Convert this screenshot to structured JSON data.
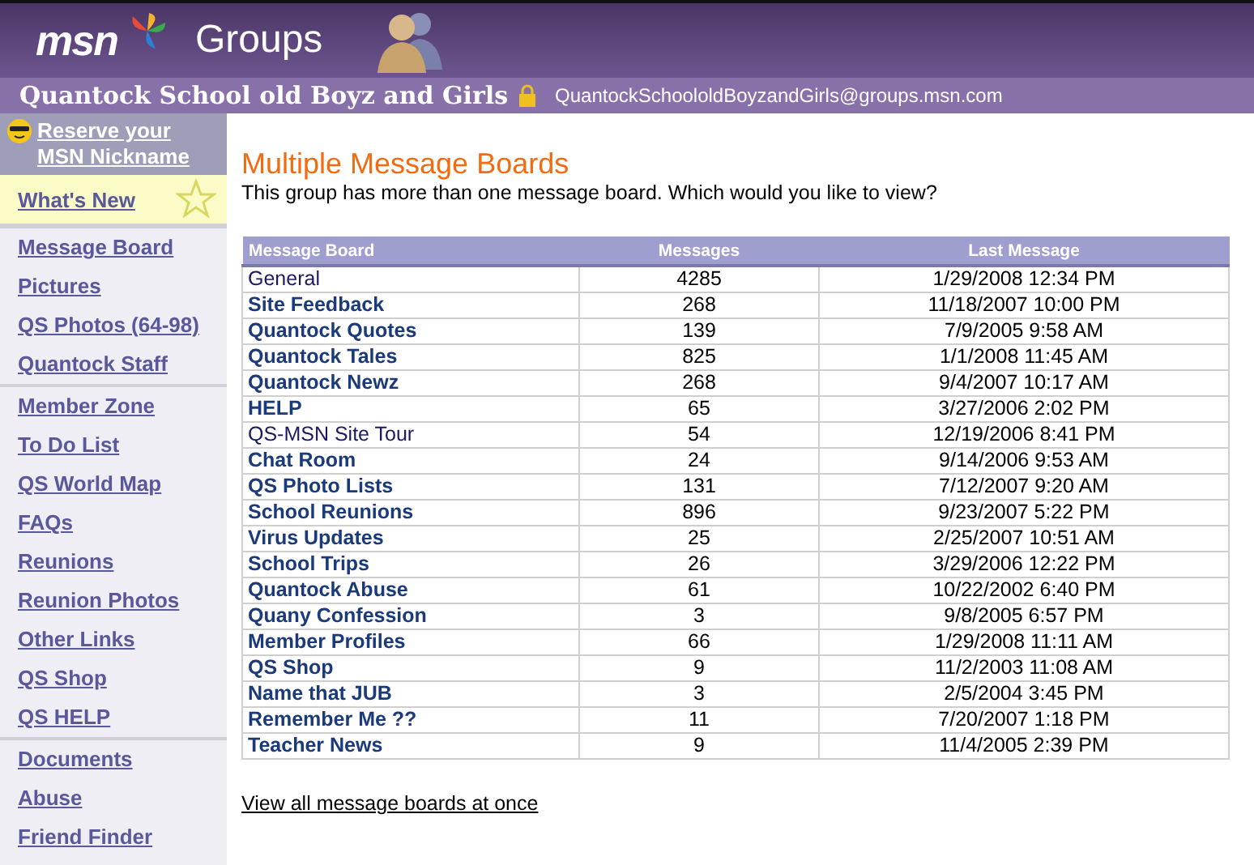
{
  "header": {
    "brand": "msn",
    "product": "Groups"
  },
  "group": {
    "name": "Quantock School old Boyz and Girls",
    "email": "QuantockSchoololdBoyzandGirls@groups.msn.com"
  },
  "sidebar": {
    "promo": "Reserve your MSN Nickname",
    "whats_new": "What's New",
    "sections": [
      [
        "Message Board",
        "Pictures",
        "QS Photos (64-98)",
        "Quantock Staff"
      ],
      [
        "Member Zone",
        "To Do List",
        "QS World Map",
        "FAQs",
        "Reunions",
        "Reunion Photos",
        "Other Links",
        "QS Shop",
        "QS HELP"
      ],
      [
        "Documents",
        "Abuse",
        "Friend Finder"
      ]
    ]
  },
  "page": {
    "title": "Multiple Message Boards",
    "intro": "This group has more than one message board. Which would you like to view?"
  },
  "table": {
    "columns": [
      "Message Board",
      "Messages",
      "Last Message"
    ],
    "rows": [
      {
        "board": "General",
        "messages": "4285",
        "last": "1/29/2008 12:34 PM",
        "unread": false
      },
      {
        "board": "Site Feedback",
        "messages": "268",
        "last": "11/18/2007 10:00 PM",
        "unread": true
      },
      {
        "board": "Quantock Quotes",
        "messages": "139",
        "last": "7/9/2005 9:58 AM",
        "unread": true
      },
      {
        "board": "Quantock Tales",
        "messages": "825",
        "last": "1/1/2008 11:45 AM",
        "unread": true
      },
      {
        "board": "Quantock Newz",
        "messages": "268",
        "last": "9/4/2007 10:17 AM",
        "unread": true
      },
      {
        "board": "HELP",
        "messages": "65",
        "last": "3/27/2006 2:02 PM",
        "unread": true
      },
      {
        "board": "QS-MSN Site Tour",
        "messages": "54",
        "last": "12/19/2006 8:41 PM",
        "unread": false
      },
      {
        "board": "Chat Room",
        "messages": "24",
        "last": "9/14/2006 9:53 AM",
        "unread": true
      },
      {
        "board": "QS Photo Lists",
        "messages": "131",
        "last": "7/12/2007 9:20 AM",
        "unread": true
      },
      {
        "board": "School Reunions",
        "messages": "896",
        "last": "9/23/2007 5:22 PM",
        "unread": true
      },
      {
        "board": "Virus Updates",
        "messages": "25",
        "last": "2/25/2007 10:51 AM",
        "unread": true
      },
      {
        "board": "School Trips",
        "messages": "26",
        "last": "3/29/2006 12:22 PM",
        "unread": true
      },
      {
        "board": "Quantock Abuse",
        "messages": "61",
        "last": "10/22/2002 6:40 PM",
        "unread": true
      },
      {
        "board": "Quany Confession",
        "messages": "3",
        "last": "9/8/2005 6:57 PM",
        "unread": true
      },
      {
        "board": "Member Profiles",
        "messages": "66",
        "last": "1/29/2008 11:11 AM",
        "unread": true
      },
      {
        "board": "QS Shop",
        "messages": "9",
        "last": "11/2/2003 11:08 AM",
        "unread": true
      },
      {
        "board": "Name that JUB",
        "messages": "3",
        "last": "2/5/2004 3:45 PM",
        "unread": true
      },
      {
        "board": "Remember Me ??",
        "messages": "11",
        "last": "7/20/2007 1:18 PM",
        "unread": true
      },
      {
        "board": "Teacher News",
        "messages": "9",
        "last": "11/4/2005 2:39 PM",
        "unread": true
      }
    ]
  },
  "view_all": "View all message boards at once"
}
